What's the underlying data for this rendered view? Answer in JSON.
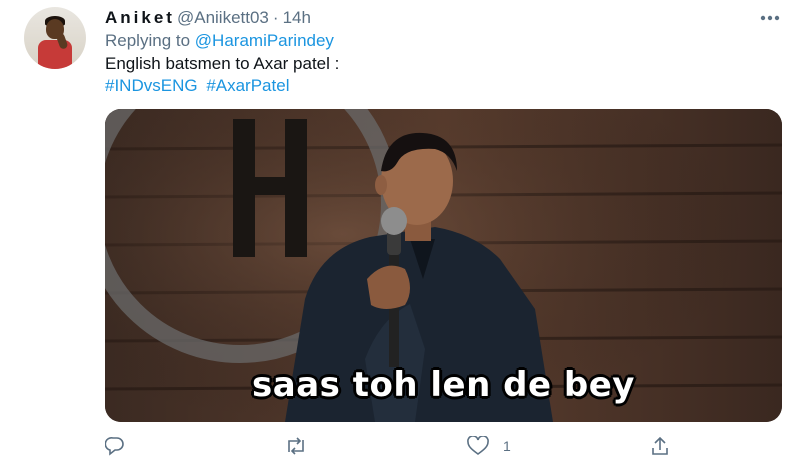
{
  "tweet": {
    "display_name": "Aniket",
    "handle": "@Aniikett03",
    "separator": "·",
    "time": "14h",
    "reply_prefix": "Replying to",
    "reply_to": "@HaramiParindey",
    "text": "English batsmen to Axar patel :",
    "hashtags": [
      "#INDvsENG",
      "#AxarPatel"
    ],
    "media": {
      "caption": "saas toh len de bey"
    },
    "actions": {
      "reply_icon": "reply-icon",
      "retweet_icon": "retweet-icon",
      "like_icon": "heart-icon",
      "like_count": "1",
      "share_icon": "share-icon"
    }
  },
  "colors": {
    "link": "#1b95e0",
    "secondary_text": "#5b7083",
    "primary_text": "#0f1419"
  }
}
